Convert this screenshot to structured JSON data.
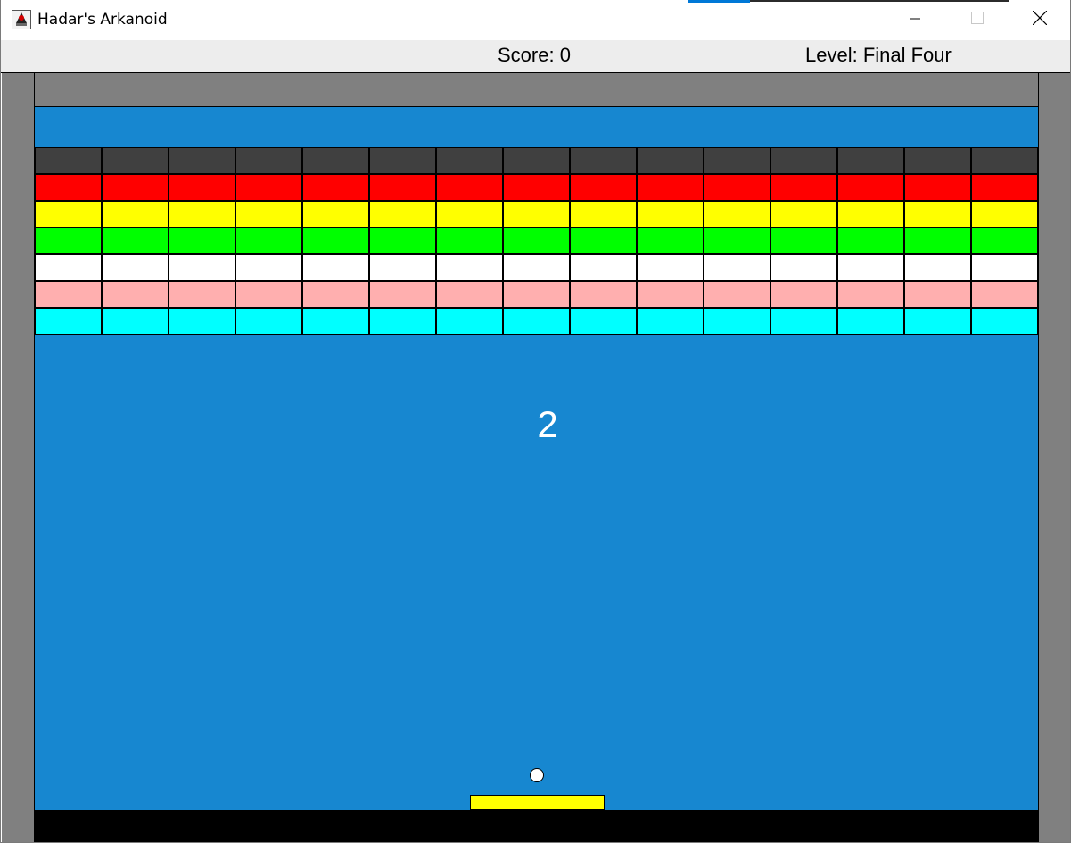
{
  "window": {
    "title": "Hadar's Arkanoid",
    "icon": "java-duke-icon",
    "controls": [
      "minimize-icon",
      "maximize-icon",
      "close-icon"
    ],
    "accent_color": "#0078d7"
  },
  "hud": {
    "score_text": "Score: 0",
    "level_text": "Level: Final Four"
  },
  "game": {
    "countdown": "2",
    "colors": {
      "background": "#1787d0",
      "wall": "#808080",
      "death_zone": "#000000",
      "paddle": "#ffff00",
      "ball": "#ffffff"
    },
    "bricks": {
      "columns": 15,
      "rows": [
        {
          "color": "#404040"
        },
        {
          "color": "#ff0000"
        },
        {
          "color": "#ffff00"
        },
        {
          "color": "#00ff00"
        },
        {
          "color": "#ffffff"
        },
        {
          "color": "#ffafaf"
        },
        {
          "color": "#00ffff"
        }
      ]
    }
  }
}
